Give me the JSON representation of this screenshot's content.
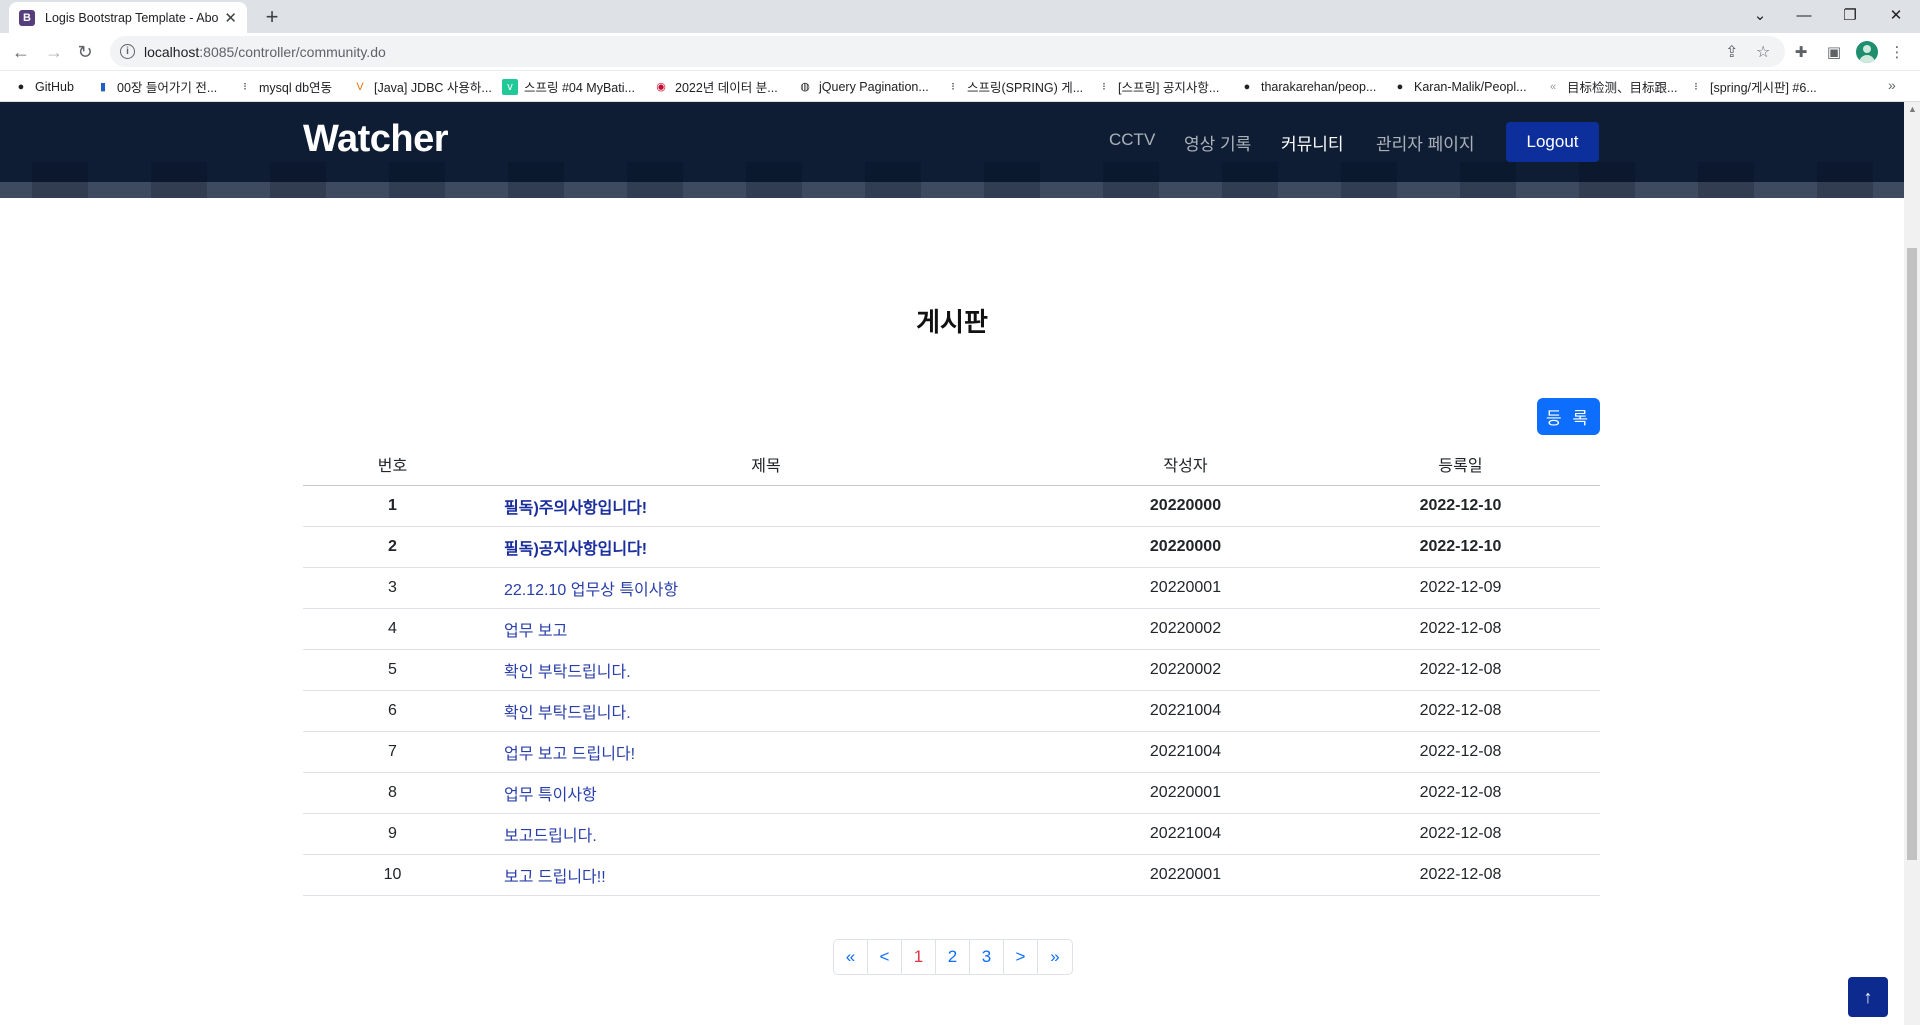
{
  "browser": {
    "tab_title": "Logis Bootstrap Template - Abo",
    "tab_favicon": "B",
    "url_host": "localhost",
    "url_path": ":8085/controller/community.do",
    "bookmarks": [
      {
        "label": "GitHub",
        "icon": "github-icon"
      },
      {
        "label": "00장 들어가기 전...",
        "icon": "doc-icon"
      },
      {
        "label": "mysql db연동",
        "icon": "dots-icon"
      },
      {
        "label": "[Java] JDBC 사용하...",
        "icon": "v-icon"
      },
      {
        "label": "스프링 #04 MyBati...",
        "icon": "v-square-icon"
      },
      {
        "label": "2022년 데이터 분...",
        "icon": "korea-flag-icon"
      },
      {
        "label": "jQuery Pagination...",
        "icon": "globe-icon"
      },
      {
        "label": "스프링(SPRING) 게...",
        "icon": "dots-icon"
      },
      {
        "label": "[스프링] 공지사항...",
        "icon": "dots-icon"
      },
      {
        "label": "tharakarehan/peop...",
        "icon": "github-icon"
      },
      {
        "label": "Karan-Malik/Peopl...",
        "icon": "github-icon"
      },
      {
        "label": "目标检测、目标跟...",
        "icon": "csdn-icon"
      },
      {
        "label": "[spring/게시판] #6...",
        "icon": "dots-icon"
      }
    ]
  },
  "header": {
    "logo": "Watcher",
    "nav": [
      "CCTV",
      "영상 기록",
      "커뮤니티",
      "관리자 페이지"
    ],
    "logout": "Logout"
  },
  "board": {
    "title": "게시판",
    "register_label": "등 록",
    "columns": [
      "번호",
      "제목",
      "작성자",
      "등록일"
    ],
    "rows": [
      {
        "num": "1",
        "title": "필독)주의사항입니다!",
        "author": "20220000",
        "date": "2022-12-10",
        "notice": true
      },
      {
        "num": "2",
        "title": "필독)공지사항입니다!",
        "author": "20220000",
        "date": "2022-12-10",
        "notice": true
      },
      {
        "num": "3",
        "title": "22.12.10 업무상 특이사항",
        "author": "20220001",
        "date": "2022-12-09",
        "notice": false
      },
      {
        "num": "4",
        "title": "업무 보고",
        "author": "20220002",
        "date": "2022-12-08",
        "notice": false
      },
      {
        "num": "5",
        "title": "확인 부탁드립니다.",
        "author": "20220002",
        "date": "2022-12-08",
        "notice": false
      },
      {
        "num": "6",
        "title": "확인 부탁드립니다.",
        "author": "20221004",
        "date": "2022-12-08",
        "notice": false
      },
      {
        "num": "7",
        "title": "업무 보고 드립니다!",
        "author": "20221004",
        "date": "2022-12-08",
        "notice": false
      },
      {
        "num": "8",
        "title": "업무 특이사항",
        "author": "20220001",
        "date": "2022-12-08",
        "notice": false
      },
      {
        "num": "9",
        "title": "보고드립니다.",
        "author": "20221004",
        "date": "2022-12-08",
        "notice": false
      },
      {
        "num": "10",
        "title": "보고 드립니다!!",
        "author": "20220001",
        "date": "2022-12-08",
        "notice": false
      }
    ]
  },
  "pagination": {
    "items": [
      "«",
      "<",
      "1",
      "2",
      "3",
      ">",
      "»"
    ],
    "current": "1"
  },
  "colors": {
    "header_bg": "#0e1d34",
    "primary": "#0d6efd",
    "logout_bg": "#0d2f9c",
    "link": "#2a3faa",
    "current_page": "#dc3545"
  }
}
